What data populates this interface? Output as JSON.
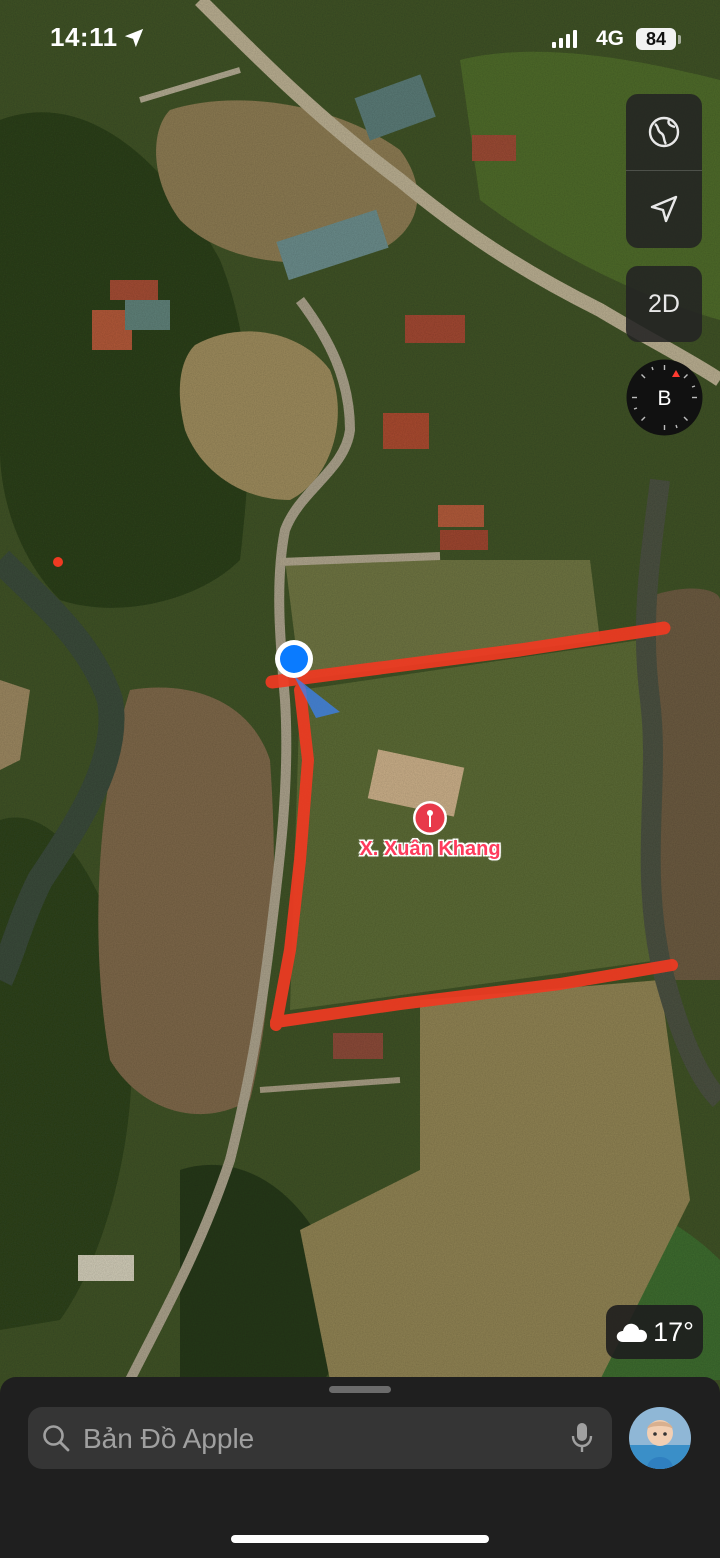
{
  "status_bar": {
    "time": "14:11",
    "network": "4G",
    "battery": "84",
    "location_icon": "location-arrow-icon",
    "signal_icon": "cellular-signal-icon"
  },
  "map": {
    "type": "satellite",
    "place_label": "X. Xuân Khang",
    "place_pin_icon": "red-map-pin-icon",
    "user_location_icon": "blue-location-dot-icon",
    "annotation_color": "#f03a22"
  },
  "controls": {
    "globe_icon": "globe-icon",
    "locate_icon": "navigation-arrow-icon",
    "view_mode": "2D",
    "compass_letter": "B"
  },
  "weather": {
    "icon": "cloud-icon",
    "temperature": "17°"
  },
  "search": {
    "placeholder": "Bản Đồ Apple",
    "search_icon": "magnifier-icon",
    "mic_icon": "microphone-icon",
    "avatar_icon": "profile-avatar-icon"
  }
}
